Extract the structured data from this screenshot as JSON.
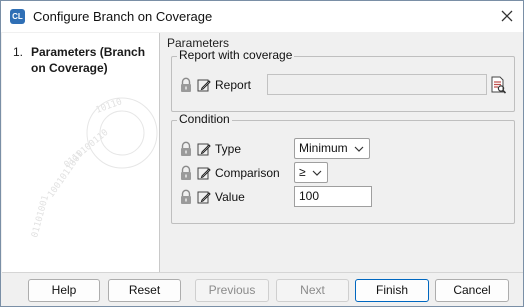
{
  "window": {
    "title": "Configure Branch on Coverage",
    "app_icon_glyph": "CL"
  },
  "sidebar": {
    "steps": [
      {
        "number": "1.",
        "label": "Parameters (Branch on Coverage)"
      }
    ]
  },
  "main": {
    "title": "Parameters",
    "report_group": {
      "legend": "Report with coverage",
      "report": {
        "label": "Report",
        "value": ""
      }
    },
    "condition_group": {
      "legend": "Condition",
      "type": {
        "label": "Type",
        "value": "Minimum"
      },
      "comparison": {
        "label": "Comparison",
        "value": "≥"
      },
      "value": {
        "label": "Value",
        "value": "100"
      }
    }
  },
  "footer": {
    "help": "Help",
    "reset": "Reset",
    "previous": "Previous",
    "next": "Next",
    "finish": "Finish",
    "cancel": "Cancel"
  },
  "colors": {
    "accent": "#0067c0",
    "app_icon": "#2f6fb5",
    "lock": "#808080"
  }
}
